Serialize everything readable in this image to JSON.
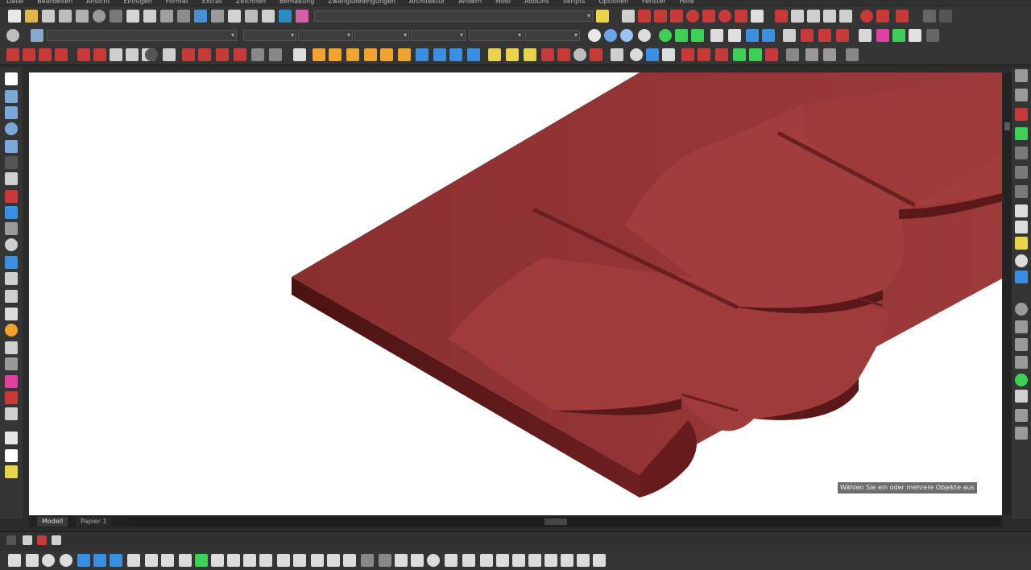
{
  "menu": {
    "items": [
      "Datei",
      "Bearbeiten",
      "Ansicht",
      "Einfügen",
      "Format",
      "Extras",
      "Zeichnen",
      "Bemaßung",
      "Zwangsbedingungen",
      "Architektur",
      "Ändern",
      "Modl",
      "AddOns",
      "Skripts",
      "Optionen",
      "Fenster",
      "Hilfe"
    ]
  },
  "canvas": {
    "status_tooltip": "Wählen Sie ein oder mehrere Objekte aus"
  },
  "tabs": [
    {
      "label": "Modell"
    },
    {
      "label": "Papier 1"
    }
  ],
  "colors": {
    "roof_top": "#9e3a3a",
    "roof_edge": "#6b1f1f",
    "roof_dark": "#4b1414"
  }
}
